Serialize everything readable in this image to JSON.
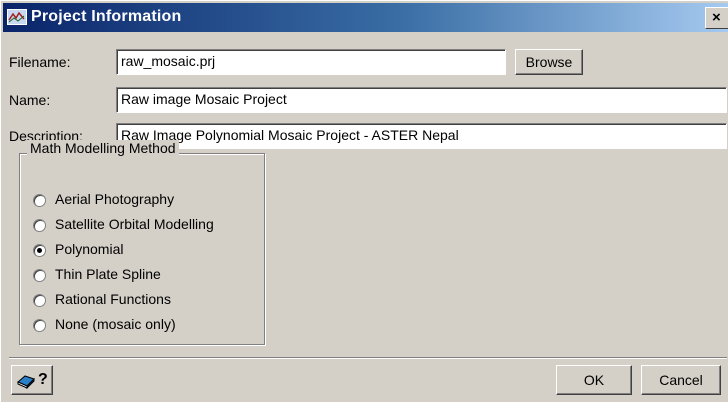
{
  "window": {
    "title": "Project Information",
    "close_glyph": "×"
  },
  "form": {
    "filename_label": "Filename:",
    "filename_value": "raw_mosaic.prj",
    "browse_label": "Browse",
    "name_label": "Name:",
    "name_value": "Raw image Mosaic Project",
    "description_label": "Description:",
    "description_value": "Raw Image Polynomial Mosaic Project - ASTER Nepal"
  },
  "method_group": {
    "legend": "Math Modelling Method",
    "options": [
      {
        "label": "Aerial Photography",
        "selected": false
      },
      {
        "label": "Satellite Orbital Modelling",
        "selected": false
      },
      {
        "label": "Polynomial",
        "selected": true
      },
      {
        "label": "Thin Plate Spline",
        "selected": false
      },
      {
        "label": "Rational Functions",
        "selected": false
      },
      {
        "label": "None (mosaic only)",
        "selected": false
      }
    ]
  },
  "footer": {
    "help_icon": "help-book-icon",
    "help_glyph": "?",
    "ok_label": "OK",
    "cancel_label": "Cancel"
  }
}
